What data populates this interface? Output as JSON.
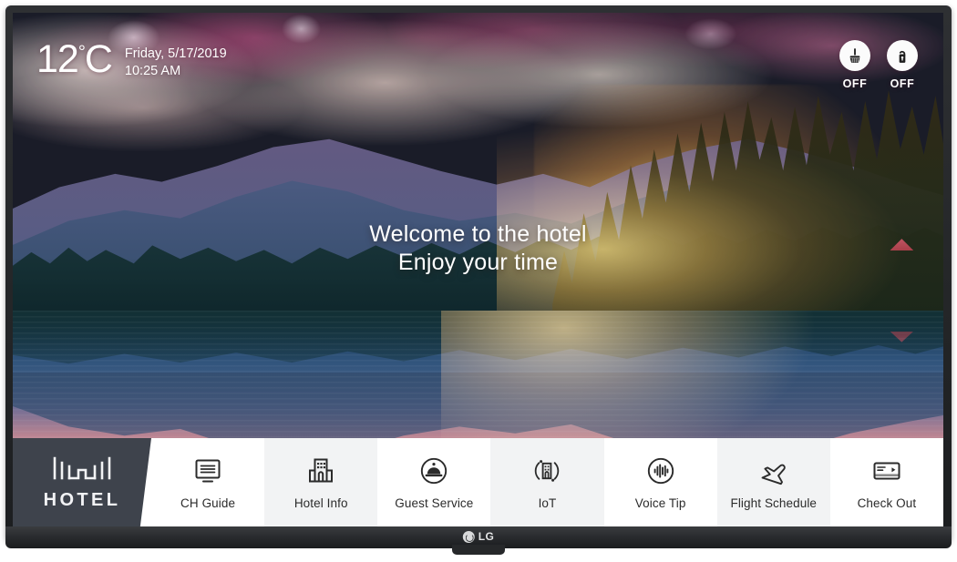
{
  "device": {
    "brand": "LG",
    "brand_mark": "lg-circle-logo"
  },
  "screen": {
    "weather": {
      "temperature": "12",
      "degree_symbol": "°",
      "unit": "C",
      "date": "Friday, 5/17/2019",
      "time": "10:25 AM"
    },
    "status_icons": [
      {
        "icon": "broom-icon",
        "name": "make-up-room",
        "label": "OFF"
      },
      {
        "icon": "do-not-disturb-icon",
        "name": "do-not-disturb",
        "label": "OFF"
      }
    ],
    "welcome": {
      "line1": "Welcome to the hotel",
      "line2": "Enjoy your time"
    },
    "menu": {
      "brand_tile": {
        "logo": "hotel-building-logo",
        "label": "HOTEL"
      },
      "items": [
        {
          "icon": "tv-guide-icon",
          "label": "CH Guide"
        },
        {
          "icon": "building-icon",
          "label": "Hotel Info"
        },
        {
          "icon": "service-bell-icon",
          "label": "Guest Service"
        },
        {
          "icon": "iot-building-icon",
          "label": "IoT"
        },
        {
          "icon": "voice-waveform-icon",
          "label": "Voice Tip"
        },
        {
          "icon": "airplane-icon",
          "label": "Flight Schedule"
        },
        {
          "icon": "credit-card-icon",
          "label": "Check Out"
        }
      ]
    }
  },
  "colors": {
    "menu_background": "#ffffff",
    "menu_alt_background": "#f2f3f4",
    "brand_tile_background": "#3e434c",
    "icon_stroke": "#2b2b2b",
    "text_on_image": "#ffffff"
  }
}
